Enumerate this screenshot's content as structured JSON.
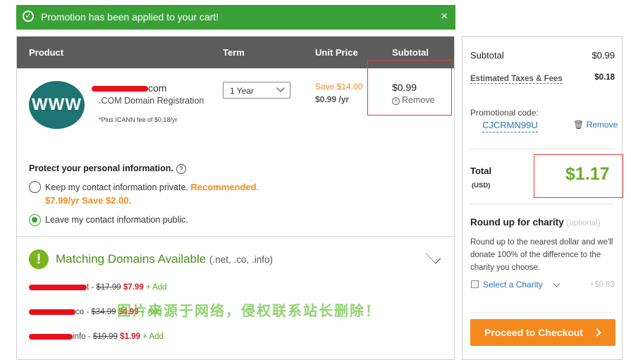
{
  "banner": {
    "message": "Promotion has been applied to your cart!",
    "close": "×",
    "icon": "check-circle-icon"
  },
  "cart": {
    "columns": [
      "Product",
      "Term",
      "Unit Price",
      "Subtotal"
    ],
    "item": {
      "logo_text": "WWW",
      "name_suffix": "com",
      "description": ".COM Domain Registration",
      "icann_note": "*Plus ICANN fee of $0.18/yr",
      "term": "1 Year",
      "save": "Save $14.00",
      "unit_price": "$0.99",
      "unit_suffix": "/yr",
      "subtotal": "$0.99",
      "remove": "Remove"
    },
    "privacy": {
      "heading": "Protect your personal information.",
      "option_private": "Keep my contact information private.",
      "recommended": "Recommended.",
      "private_price": "$7.99/yr Save $2.00.",
      "option_public": "Leave my contact information public.",
      "selected": "public"
    },
    "matching": {
      "title": "Matching Domains Available",
      "tlds": "(.net, .co, .info)",
      "domains": [
        {
          "suffix": "t",
          "old_price": "$17.99",
          "new_price": "$7.99",
          "add": "+ Add"
        },
        {
          "suffix": "co",
          "old_price": "$34.99",
          "new_price": "$4.99",
          "add": "+ Add"
        },
        {
          "suffix": "info",
          "old_price": "$19.99",
          "new_price": "$1.99",
          "add": "+ Add"
        }
      ]
    },
    "watermark": "图片来源于网络，侵权联系站长删除！"
  },
  "summary": {
    "subtotal_label": "Subtotal",
    "subtotal_value": "$0.99",
    "taxes_label": "Estimated Taxes & Fees",
    "taxes_value": "$0.18",
    "promo_label": "Promotional code:",
    "promo_code": "CJCRMN99U",
    "promo_remove": "Remove",
    "total_label": "Total",
    "currency": "(USD)",
    "total_value": "$1.17",
    "charity_title": "Round up for charity",
    "charity_optional": "(optional)",
    "charity_text": "Round up to the nearest dollar and we'll donate 100% of the difference to the charity you choose.",
    "select_charity": "Select a Charity",
    "charity_amount": "+$0.83",
    "checkout": "Proceed to Checkout"
  },
  "colors": {
    "green": "#3aa138",
    "orange": "#f4891e",
    "link": "#2a75b8",
    "red": "#d0191f"
  }
}
